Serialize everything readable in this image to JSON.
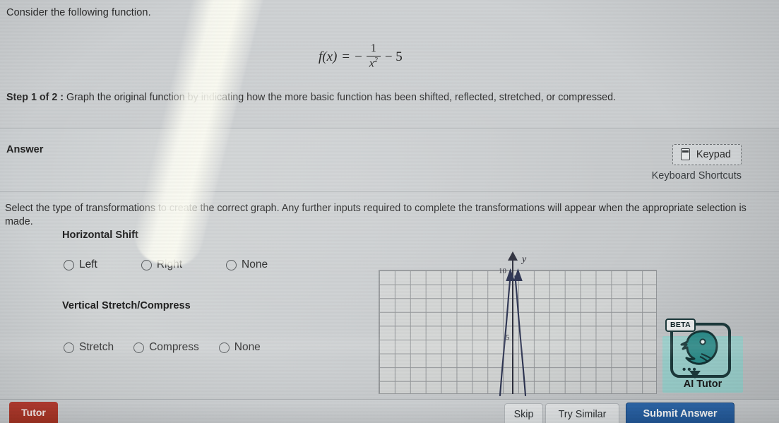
{
  "question": {
    "intro": "Consider the following function.",
    "formula": {
      "lhs": "f(x)",
      "equals": "=",
      "sign": "−",
      "numerator": "1",
      "denominator": "x",
      "denominator_exponent": "2",
      "trailing": "− 5",
      "plain": "f(x) = -1/x^2 - 5"
    },
    "step_label": "Step 1 of 2 :",
    "step_text": "Graph the original function by indicating how the more basic function has been shifted, reflected, stretched, or compressed."
  },
  "answer": {
    "label": "Answer",
    "keypad_button": "Keypad",
    "keypad_icon": "keypad-icon",
    "keyboard_shortcuts": "Keyboard Shortcuts"
  },
  "transformations": {
    "instructions": "Select the type of transformations to create the correct graph. Any further inputs required to complete the transformations will appear when the appropriate selection is made.",
    "groups": [
      {
        "title": "Horizontal Shift",
        "options": [
          {
            "label": "Left",
            "selected": false
          },
          {
            "label": "Right",
            "selected": false
          },
          {
            "label": "None",
            "selected": false
          }
        ]
      },
      {
        "title": "Vertical Stretch/Compress",
        "options": [
          {
            "label": "Stretch",
            "selected": false
          },
          {
            "label": "Compress",
            "selected": false
          },
          {
            "label": "None",
            "selected": false
          }
        ]
      }
    ]
  },
  "graph": {
    "y_axis_label": "y",
    "tick_labels": [
      "10",
      "5"
    ],
    "curve_color": "#2d3452",
    "grid_color": "#8e9194",
    "description": "Two upward branches asymptotic to the y-axis with arrowheads at the top"
  },
  "ai_tutor": {
    "label": "AI Tutor",
    "badge": "BETA",
    "dots": "•••",
    "icon": "eagle-icon",
    "accent_color": "#9fd6d2",
    "outline_color": "#1c3a3c"
  },
  "bottom_bar": {
    "tutor_label": "Tutor",
    "tutor_color": "#a5301f",
    "skip_label": "Skip",
    "try_similar_label": "Try Similar",
    "submit_label": "Submit Answer",
    "submit_color": "#1f5596"
  },
  "chart_data": {
    "type": "line",
    "title": "",
    "xlabel": "",
    "ylabel": "y",
    "xlim": [
      -9,
      9
    ],
    "ylim": [
      -8,
      10
    ],
    "grid": true,
    "legend": "none",
    "tick_labels_y": [
      10,
      5
    ],
    "series": [
      {
        "name": "branch-left",
        "x": [
          -0.78,
          -0.62,
          -0.5,
          -0.42,
          -0.36,
          -0.32,
          -0.29,
          -0.27,
          -0.26
        ],
        "y": [
          -8.0,
          -4.0,
          0.0,
          3.0,
          5.5,
          7.3,
          8.6,
          9.4,
          10.0
        ]
      },
      {
        "name": "branch-right",
        "x": [
          0.78,
          0.62,
          0.5,
          0.42,
          0.36,
          0.32,
          0.29,
          0.27,
          0.26
        ],
        "y": [
          -8.0,
          -4.0,
          0.0,
          3.0,
          5.5,
          7.3,
          8.6,
          9.4,
          10.0
        ]
      }
    ]
  }
}
